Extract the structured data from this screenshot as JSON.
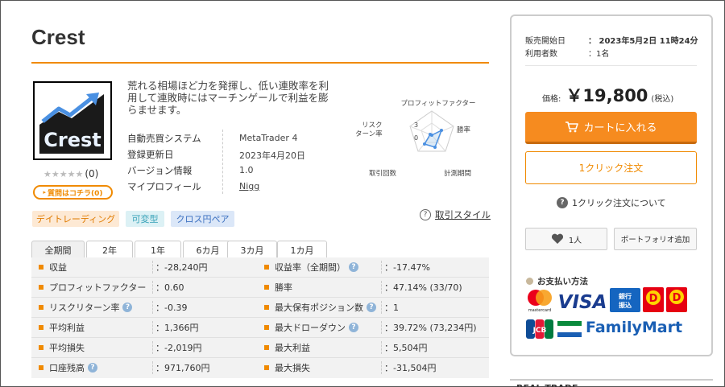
{
  "product": {
    "title": "Crest",
    "logo_text": "Crest",
    "rating": {
      "stars": "★★★★★",
      "count": "(0)",
      "value": 0
    },
    "question_button": "質問はコチラ(0)",
    "description": "荒れる相場ほど力を発揮し、低い連敗率を利用して連敗時にはマーチンゲールで利益を膨らませます。",
    "info": [
      {
        "label": "自動売買システム",
        "value": "MetaTrader 4"
      },
      {
        "label": "登録更新日",
        "value": "2023年4月20日"
      },
      {
        "label": "バージョン情報",
        "value": "1.0"
      },
      {
        "label": "マイプロフィール",
        "value": "Nigg"
      }
    ],
    "tags": [
      "デイトレーディング",
      "可変型",
      "クロス円ペア"
    ],
    "trade_style_link": "取引スタイル"
  },
  "radar": {
    "labels": [
      "プロフィットファクター",
      "勝率",
      "計測期間",
      "取引回数",
      "リスクリターン率"
    ],
    "label_lines": {
      "risk_1": "リスク",
      "risk_2": "ターン率"
    },
    "tick_high": "3",
    "tick_low": "0"
  },
  "period_tabs": [
    "全期間",
    "2年",
    "1年",
    "6カ月",
    "3カ月",
    "1カ月"
  ],
  "stats": {
    "left": [
      {
        "label": "収益",
        "value": "：-28,240円",
        "hint": false
      },
      {
        "label": "プロフィットファクター",
        "value": "：0.60",
        "hint": false
      },
      {
        "label": "リスクリターン率",
        "value": "：-0.39",
        "hint": true
      },
      {
        "label": "平均利益",
        "value": "：1,366円",
        "hint": false
      },
      {
        "label": "平均損失",
        "value": "：-2,019円",
        "hint": false
      },
      {
        "label": "口座残高",
        "value": "：971,760円",
        "hint": true
      }
    ],
    "right": [
      {
        "label": "収益率（全期間）",
        "value": "：-17.47%",
        "hint": true
      },
      {
        "label": "勝率",
        "value": "：47.14% (33/70)",
        "hint": false
      },
      {
        "label": "最大保有ポジション数",
        "value": "：1",
        "hint": true
      },
      {
        "label": "最大ドローダウン",
        "value": "：39.72% (73,234円)",
        "hint": true
      },
      {
        "label": "最大利益",
        "value": "：5,504円",
        "hint": false
      },
      {
        "label": "最大損失",
        "value": "：-31,504円",
        "hint": false
      }
    ]
  },
  "purchase": {
    "release_label": "販売開始日",
    "release_value": "：  2023年5月2日 11時24分",
    "users_label": "利用者数",
    "users_value": "：1名",
    "price_label": "価格:",
    "price_value": "￥19,800",
    "price_tax": "(税込)",
    "cart_button": "カートに入れる",
    "oneclick_button": "1クリック注文",
    "about_oneclick": "1クリック注文について",
    "like_count": "1人",
    "portfolio_button": "ポートフォリオ追加",
    "payment_title": "お支払い方法",
    "payment_labels": {
      "mastercard": "mastercard",
      "visa": "VISA",
      "bank_1": "銀行",
      "bank_2": "振込",
      "familymart": "FamilyMart",
      "jcb": "JCB"
    }
  },
  "next_section": "REAL TRADE",
  "colors": {
    "accent": "#f08a00",
    "cart": "#f68b1f",
    "stat_bg": "#f2f2f2"
  }
}
